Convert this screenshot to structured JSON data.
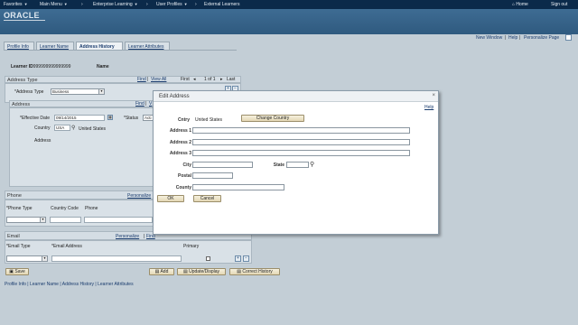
{
  "topnav": {
    "favorites": "Favorites",
    "main_menu": "Main Menu",
    "crumb1": "Enterprise Learning",
    "crumb2": "User Profiles",
    "crumb3": "External Learners",
    "home": "Home",
    "sign_out": "Sign out"
  },
  "brand": {
    "logo": "ORACLE"
  },
  "page_links": {
    "new_window": "New Window",
    "help": "Help",
    "personalize": "Personalize Page"
  },
  "tabs": [
    "Profile Info",
    "Learner Name",
    "Address History",
    "Learner Attributes"
  ],
  "learner": {
    "id_label": "Learner ID",
    "id_value": "999999999999999",
    "name_label": "Name"
  },
  "address_type_section": {
    "title": "Address Type",
    "nav": {
      "find": "Find",
      "view_all": "View All",
      "first": "First",
      "counter": "1 of 1",
      "last": "Last"
    },
    "type_label": "*Address Type",
    "type_value": "Business"
  },
  "address_section": {
    "title": "Address",
    "nav": {
      "find": "Find",
      "view": "V"
    },
    "eff_date_label": "*Effective Date",
    "eff_date_value": "09/14/2015",
    "status_label": "*Status",
    "status_value": "Acti",
    "country_label": "Country",
    "country_code": "USA",
    "country_name": "United States",
    "address_label": "Address"
  },
  "phone_section": {
    "title": "Phone",
    "personalize": "Personalize",
    "cols": [
      "*Phone Type",
      "Country Code",
      "Phone"
    ]
  },
  "email_section": {
    "title": "Email",
    "personalize": "Personalize",
    "find": "Find",
    "cols": [
      "*Email Type",
      "*Email Address",
      "Primary"
    ]
  },
  "bottom": {
    "save": "Save",
    "add": "Add",
    "update_display": "Update/Display",
    "correct_history": "Correct History",
    "footer_links": "Profile Info | Learner Name | Address History | Learner Attributes"
  },
  "modal": {
    "title": "Edit Address",
    "help": "Help",
    "country_label": "Cntry",
    "country_value": "United States",
    "change_country": "Change Country",
    "address1": "Address 1",
    "address2": "Address 2",
    "address3": "Address 3",
    "city": "City",
    "state": "State",
    "postal": "Postal",
    "county": "County",
    "ok": "OK",
    "cancel": "Cancel"
  }
}
